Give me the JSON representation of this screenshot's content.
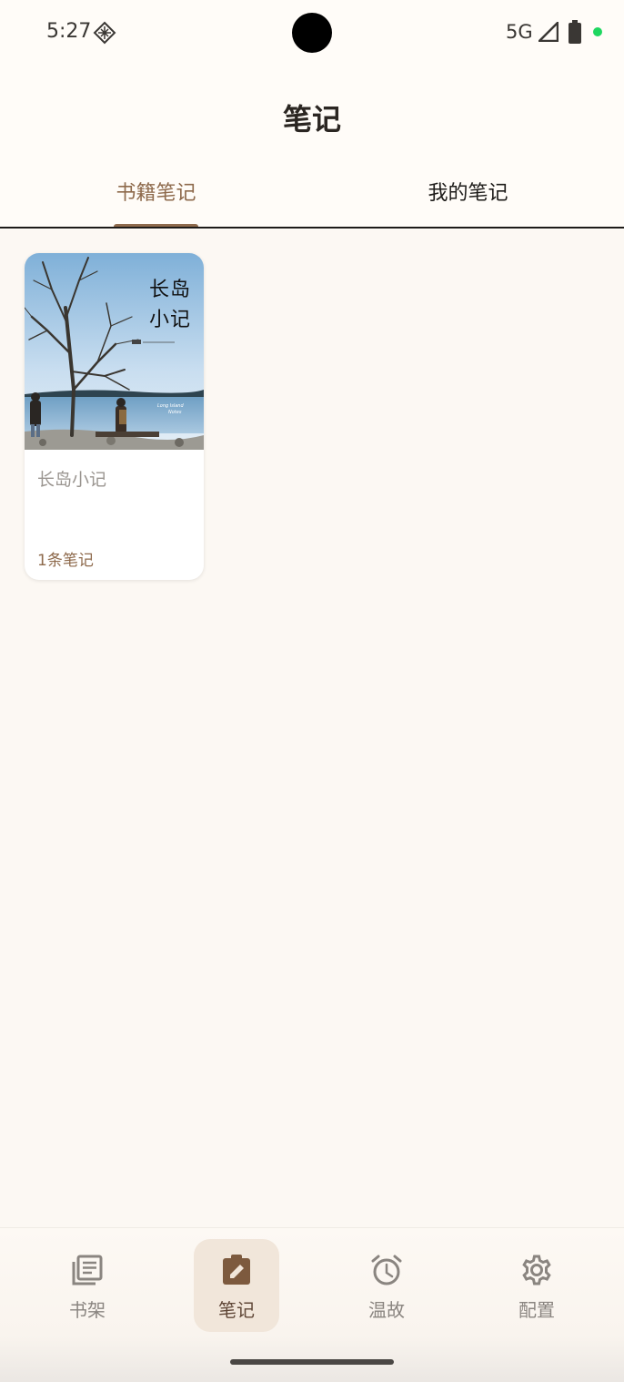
{
  "status_bar": {
    "time": "5:27",
    "network": "5G",
    "icons": [
      "diamond-grid-icon",
      "signal-icon",
      "battery-icon",
      "notification-dot"
    ],
    "dot_color": "#1ed760"
  },
  "header": {
    "title": "笔记",
    "tabs": [
      {
        "label": "书籍笔记",
        "selected": true
      },
      {
        "label": "我的笔记",
        "selected": false
      }
    ]
  },
  "books": [
    {
      "cover_title_line1": "长岛",
      "cover_title_line2": "小记",
      "title": "长岛小记",
      "note_count": "1条笔记"
    }
  ],
  "bottom_nav": {
    "items": [
      {
        "label": "书架",
        "icon": "bookshelf-icon",
        "active": false
      },
      {
        "label": "笔记",
        "icon": "edit-note-icon",
        "active": true
      },
      {
        "label": "温故",
        "icon": "alarm-clock-icon",
        "active": false
      },
      {
        "label": "配置",
        "icon": "gear-icon",
        "active": false
      }
    ]
  },
  "colors": {
    "accent": "#8e6a4c",
    "background": "#fcf8f3",
    "nav_active_bg": "#f1e6da"
  }
}
